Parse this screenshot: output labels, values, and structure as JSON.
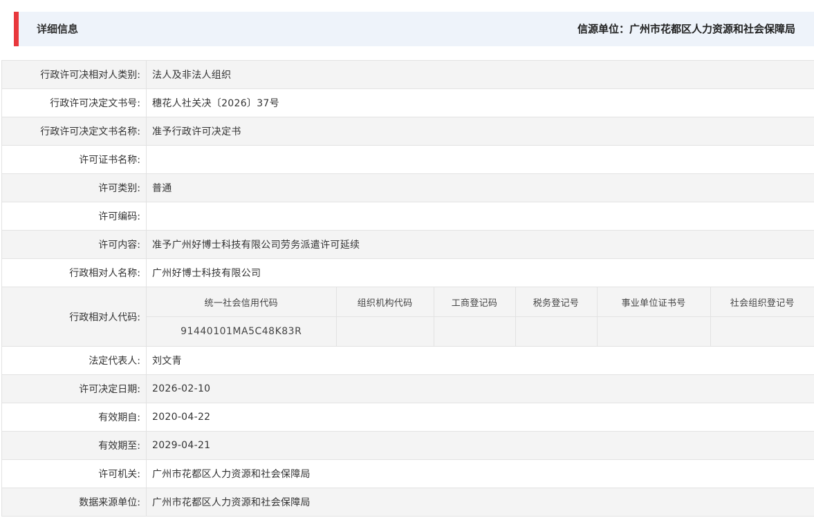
{
  "header": {
    "title": "详细信息",
    "source": "信源单位：广州市花都区人力资源和社会保障局"
  },
  "rows_top": [
    {
      "label": "行政许可决相对人类别:",
      "value": "法人及非法人组织"
    },
    {
      "label": "行政许可决定文书号:",
      "value": "穗花人社关决〔2026〕37号"
    },
    {
      "label": "行政许可决定文书名称:",
      "value": "准予行政许可决定书"
    },
    {
      "label": "许可证书名称:",
      "value": ""
    },
    {
      "label": "许可类别:",
      "value": "普通"
    },
    {
      "label": "许可编码:",
      "value": ""
    },
    {
      "label": "许可内容:",
      "value": "准予广州好博士科技有限公司劳务派遣许可延续"
    },
    {
      "label": "行政相对人名称:",
      "value": "广州好博士科技有限公司"
    }
  ],
  "code_row": {
    "label": "行政相对人代码:",
    "headers": [
      "统一社会信用代码",
      "组织机构代码",
      "工商登记码",
      "税务登记号",
      "事业单位证书号",
      "社会组织登记号"
    ],
    "values": [
      "91440101MA5C48K83R",
      "",
      "",
      "",
      "",
      ""
    ]
  },
  "rows_bottom": [
    {
      "label": "法定代表人:",
      "value": "刘文青"
    },
    {
      "label": "许可决定日期:",
      "value": "2026-02-10"
    },
    {
      "label": "有效期自:",
      "value": "2020-04-22"
    },
    {
      "label": "有效期至:",
      "value": "2029-04-21"
    },
    {
      "label": "许可机关:",
      "value": "广州市花都区人力资源和社会保障局"
    },
    {
      "label": "数据来源单位:",
      "value": "广州市花都区人力资源和社会保障局"
    }
  ],
  "colors": {
    "accent": "#e8383d",
    "header_bg": "#eef3fa",
    "row_alt": "#f4f4f4",
    "border": "#e2e2e2"
  }
}
